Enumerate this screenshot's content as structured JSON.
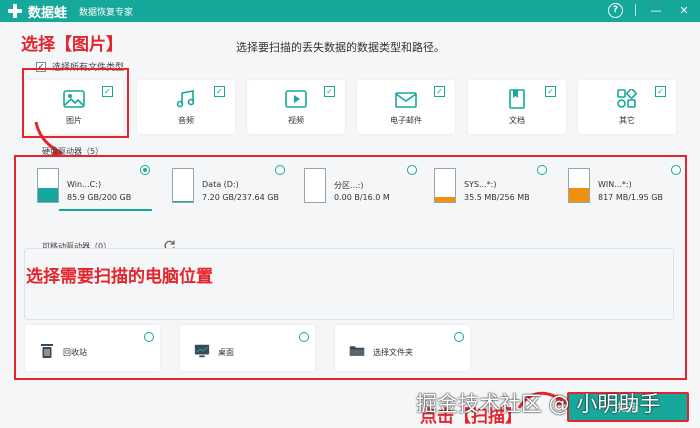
{
  "app": {
    "title": "数据蛙",
    "subtitle": "数据恢复专家",
    "help_glyph": "?",
    "minimize_glyph": "—",
    "close_glyph": "✕",
    "accent_color": "#16a89a"
  },
  "annotations": {
    "step1": "选择【图片】",
    "step2": "选择需要扫描的电脑位置",
    "step3": "点击【扫描】",
    "color": "#e3262d"
  },
  "instruction": "选择要扫描的丢失数据的数据类型和路径。",
  "select_all": {
    "label": "选择所有文件类型",
    "checked": true
  },
  "file_types": [
    {
      "label": "图片",
      "icon": "image-icon",
      "checked": true
    },
    {
      "label": "音频",
      "icon": "music-icon",
      "checked": true
    },
    {
      "label": "视频",
      "icon": "video-icon",
      "checked": true
    },
    {
      "label": "电子邮件",
      "icon": "email-icon",
      "checked": true
    },
    {
      "label": "文档",
      "icon": "document-icon",
      "checked": true
    },
    {
      "label": "其它",
      "icon": "other-icon",
      "checked": true
    }
  ],
  "hard_drives": {
    "title": "硬盘驱动器（5）",
    "items": [
      {
        "name": "Win...C:)",
        "size": "85.9 GB/200 GB",
        "used_fraction": 0.43,
        "fill_color": "#16a89a",
        "selected": true
      },
      {
        "name": "Data (D:)",
        "size": "7.20 GB/237.64 GB",
        "used_fraction": 0.03,
        "fill_color": "#16a89a",
        "selected": false
      },
      {
        "name": "分区...:)",
        "size": "0.00  B/16.0 M",
        "used_fraction": 0.0,
        "fill_color": "#f0900f",
        "selected": false
      },
      {
        "name": "SYS...*:)",
        "size": "35.5 MB/256 MB",
        "used_fraction": 0.14,
        "fill_color": "#f0900f",
        "selected": false
      },
      {
        "name": "WIN...*:)",
        "size": "817 MB/1.95 GB",
        "used_fraction": 0.42,
        "fill_color": "#f0900f",
        "selected": false
      }
    ]
  },
  "removable": {
    "title": "可移动驱动器（0）",
    "refresh_icon": "refresh-icon"
  },
  "locations": [
    {
      "label": "回收站",
      "icon": "recycle-bin-icon"
    },
    {
      "label": "桌面",
      "icon": "desktop-icon"
    },
    {
      "label": "选择文件夹",
      "icon": "folder-icon"
    }
  ],
  "scan_button": "扫描",
  "watermark": "掘金技术社区 @ 小明助手"
}
